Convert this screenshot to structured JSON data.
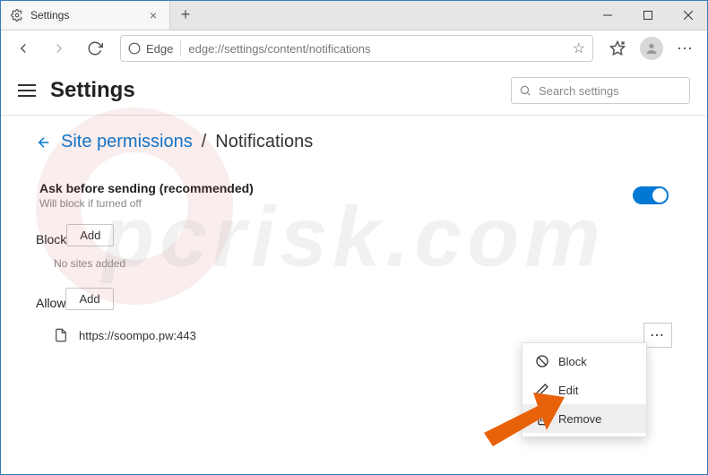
{
  "window": {
    "tab_title": "Settings",
    "newtab_glyph": "+",
    "close_glyph": "×"
  },
  "toolbar": {
    "edge_label": "Edge",
    "url": "edge://settings/content/notifications",
    "more_glyph": "⋯"
  },
  "header": {
    "title": "Settings",
    "search_placeholder": "Search settings"
  },
  "breadcrumb": {
    "parent": "Site permissions",
    "separator": "/",
    "current": "Notifications"
  },
  "ask": {
    "title": "Ask before sending (recommended)",
    "subtitle": "Will block if turned off",
    "enabled": true
  },
  "block": {
    "title": "Block",
    "add_label": "Add",
    "empty_text": "No sites added"
  },
  "allow": {
    "title": "Allow",
    "add_label": "Add",
    "sites": [
      {
        "url": "https://soompo.pw:443"
      }
    ],
    "more_glyph": "⋯"
  },
  "context_menu": {
    "items": [
      {
        "label": "Block",
        "icon": "block"
      },
      {
        "label": "Edit",
        "icon": "edit"
      },
      {
        "label": "Remove",
        "icon": "trash",
        "hover": true
      }
    ]
  },
  "watermark": "pcrisk.com"
}
